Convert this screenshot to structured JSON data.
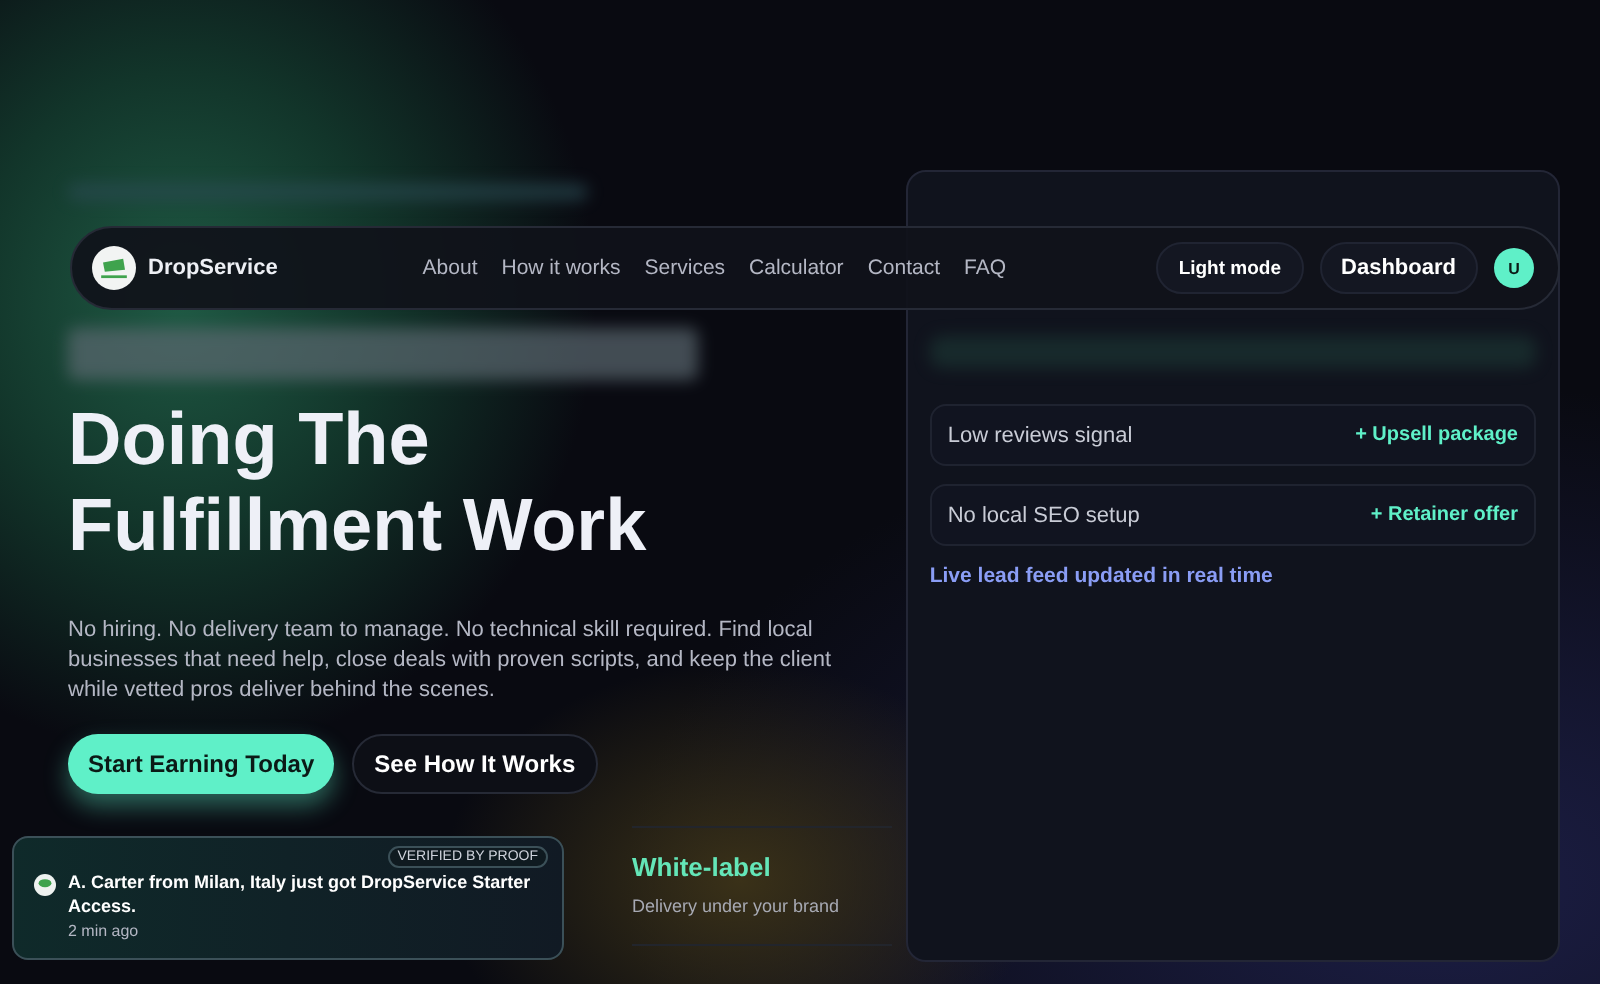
{
  "navbar": {
    "brand": "DropService",
    "links": [
      "About",
      "How it works",
      "Services",
      "Calculator",
      "Contact",
      "FAQ"
    ],
    "theme_button": "Light mode",
    "dashboard_button": "Dashboard",
    "avatar": "U"
  },
  "hero": {
    "heading_lines": [
      "Doing The",
      "Fulfillment Work"
    ],
    "description": "No hiring. No delivery team to manage. No technical skill required. Find local businesses that need help, close deals with proven scripts, and keep the client while vetted pros deliver behind the scenes.",
    "primary_button": "Start Earning Today",
    "secondary_button": "See How It Works"
  },
  "lead_panel": {
    "signals": [
      {
        "label": "Low reviews signal",
        "action": "+ Upsell package"
      },
      {
        "label": "No local SEO setup",
        "action": "+ Retainer offer"
      }
    ],
    "footer": "Live lead feed updated in real time"
  },
  "feature": {
    "title": "White-label",
    "subtitle": "Delivery under your brand"
  },
  "toast": {
    "badge": "VERIFIED BY PROOF",
    "message": "**A. Carter** from **Milan, Italy** just got **DropService Starter Access.**",
    "time": "2 min ago"
  }
}
